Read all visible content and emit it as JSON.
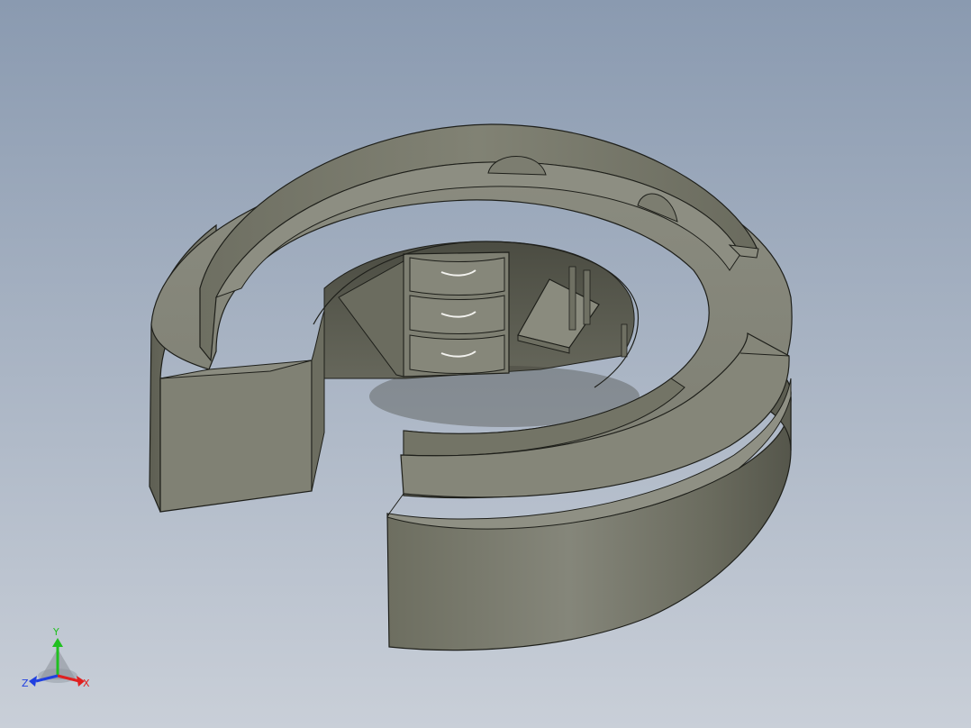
{
  "view": {
    "background_top": "#8a9ab0",
    "background_bottom": "#c9cfd8",
    "model_fill": "#7a7b6c",
    "model_edge": "#1e1f1a"
  },
  "triad": {
    "x_label": "X",
    "y_label": "Y",
    "z_label": "Z",
    "x_color": "#e02020",
    "y_color": "#20c020",
    "z_color": "#2040e0"
  }
}
